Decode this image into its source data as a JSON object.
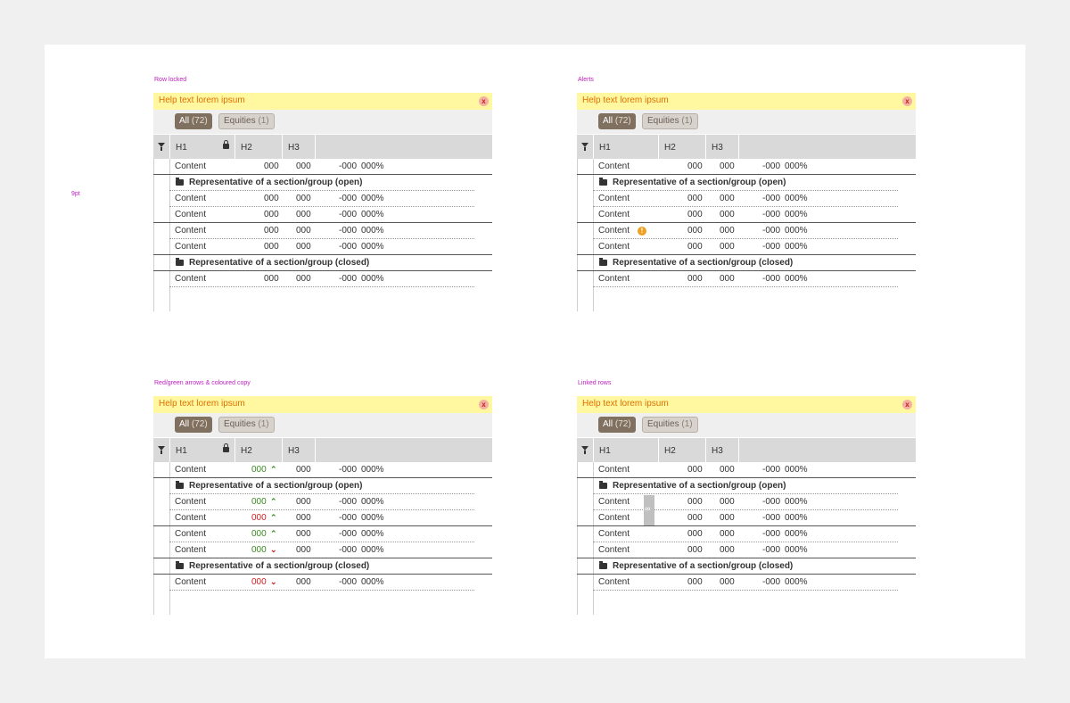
{
  "side_label": "9pt",
  "help_text": "Help text lorem ipsum",
  "help_close": "x",
  "tabs": {
    "all_label": "All",
    "all_count": "(72)",
    "eq_label": "Equities",
    "eq_count": "(1)"
  },
  "headers": {
    "h1": "H1",
    "h2": "H2",
    "h3": "H3"
  },
  "content_label": "Content",
  "values": {
    "v1": "000",
    "v2": "000",
    "v3": "-000",
    "v4": "000%"
  },
  "groups": {
    "open": "Representative of a section/group (open)",
    "closed": "Representative of a section/group (closed)"
  },
  "alert_glyph": "!",
  "arrow_up": "⌃",
  "arrow_down": "⌄",
  "panels": [
    {
      "title": "Row locked",
      "variant": "locked"
    },
    {
      "title": "Alerts",
      "variant": "alerts"
    },
    {
      "title": "Red/green arrows & coloured copy",
      "variant": "arrows"
    },
    {
      "title": "Linked rows",
      "variant": "linked"
    }
  ],
  "colors": {
    "help_bg": "#fff8a0",
    "help_text": "#e07000",
    "label": "#c020c0",
    "green": "#3a8a20",
    "red": "#d02020",
    "alert": "#f0a020"
  }
}
